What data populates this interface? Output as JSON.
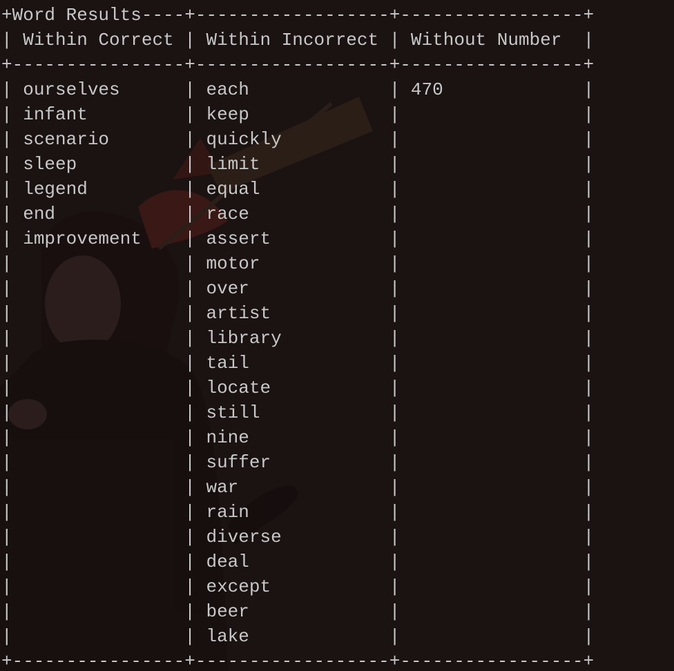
{
  "table": {
    "title": "Word Results",
    "columns": [
      "Within Correct",
      "Within Incorrect",
      "Without Number"
    ],
    "within_correct": [
      "ourselves",
      "infant",
      "scenario",
      "sleep",
      "legend",
      "end",
      "improvement"
    ],
    "within_incorrect": [
      "each",
      "keep",
      "quickly",
      "limit",
      "equal",
      "race",
      "assert",
      "motor",
      "over",
      "artist",
      "library",
      "tail",
      "locate",
      "still",
      "nine",
      "suffer",
      "war",
      "rain",
      "diverse",
      "deal",
      "except",
      "beer",
      "lake"
    ],
    "without_number": [
      "470"
    ]
  },
  "colors": {
    "background": "#1b1212",
    "text": "#c8c8c8"
  }
}
